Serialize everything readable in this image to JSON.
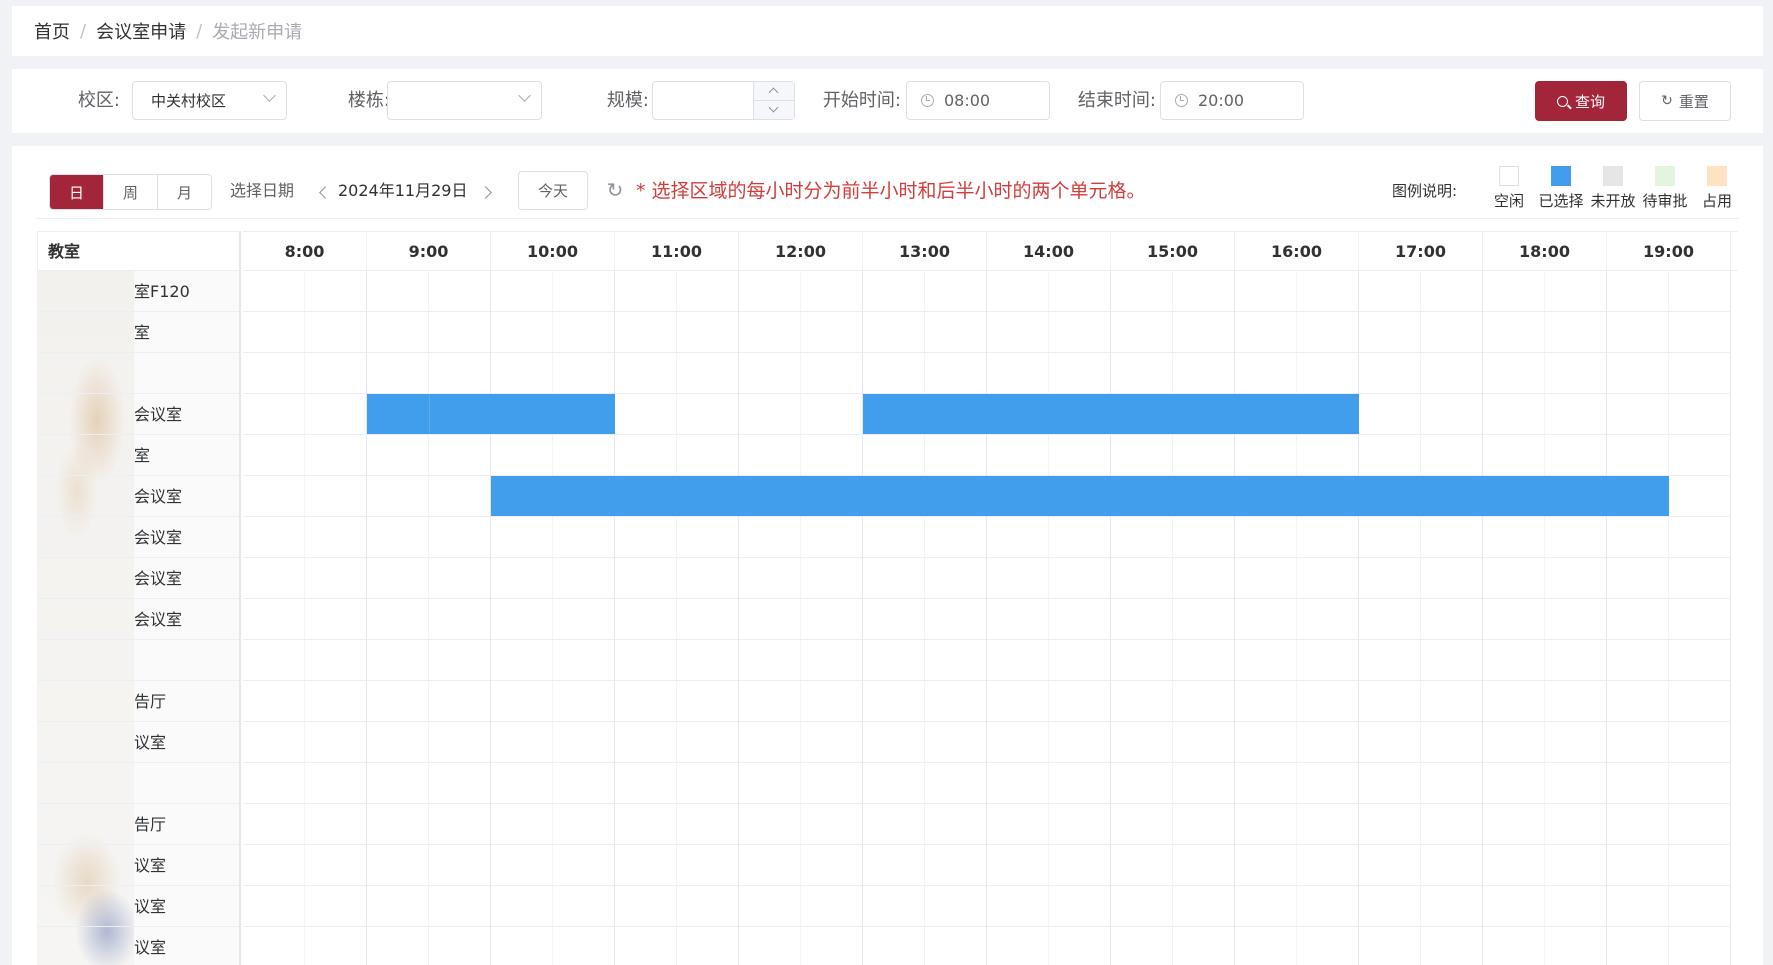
{
  "breadcrumb": {
    "home": "首页",
    "sep": "/",
    "section": "会议室申请",
    "current": "发起新申请"
  },
  "filters": {
    "campus_label": "校区:",
    "campus_value": "中关村校区",
    "building_label": "楼栋:",
    "building_value": "",
    "scale_label": "规模:",
    "scale_value": "",
    "start_label": "开始时间:",
    "start_value": "08:00",
    "end_label": "结束时间:",
    "end_value": "20:00",
    "query_button": "查询",
    "reset_button": "重置"
  },
  "toolbar": {
    "views": [
      "日",
      "周",
      "月"
    ],
    "active_view": "日",
    "select_date_label": "选择日期",
    "date": "2024年11月29日",
    "today_button": "今天",
    "hint": "* 选择区域的每小时分为前半小时和后半小时的两个单元格。"
  },
  "legend": {
    "title": "图例说明:",
    "items": [
      {
        "label": "空闲",
        "color": "#ffffff"
      },
      {
        "label": "已选择",
        "color": "#409eed"
      },
      {
        "label": "未开放",
        "color": "#e6e6e6"
      },
      {
        "label": "待审批",
        "color": "#e3f5dc"
      },
      {
        "label": "占用",
        "color": "#fde3c2"
      }
    ]
  },
  "grid": {
    "room_header": "教室",
    "hours": [
      "8:00",
      "9:00",
      "10:00",
      "11:00",
      "12:00",
      "13:00",
      "14:00",
      "15:00",
      "16:00",
      "17:00",
      "18:00",
      "19:00"
    ],
    "rooms": [
      "室F120",
      "室",
      "",
      "会议室",
      "室",
      "会议室",
      "会议室",
      "会议室",
      "会议室",
      "",
      "告厅",
      "议室",
      "",
      "告厅",
      "议室",
      "议室",
      "议室"
    ],
    "bookings": [
      {
        "row": 3,
        "start": "9:00",
        "end": "11:00"
      },
      {
        "row": 3,
        "start": "13:00",
        "end": "17:00"
      },
      {
        "row": 5,
        "start": "10:00",
        "end": "19:30"
      }
    ]
  },
  "colors": {
    "accent": "#a3253a",
    "selected": "#409eed",
    "hint": "#d33c3c"
  }
}
